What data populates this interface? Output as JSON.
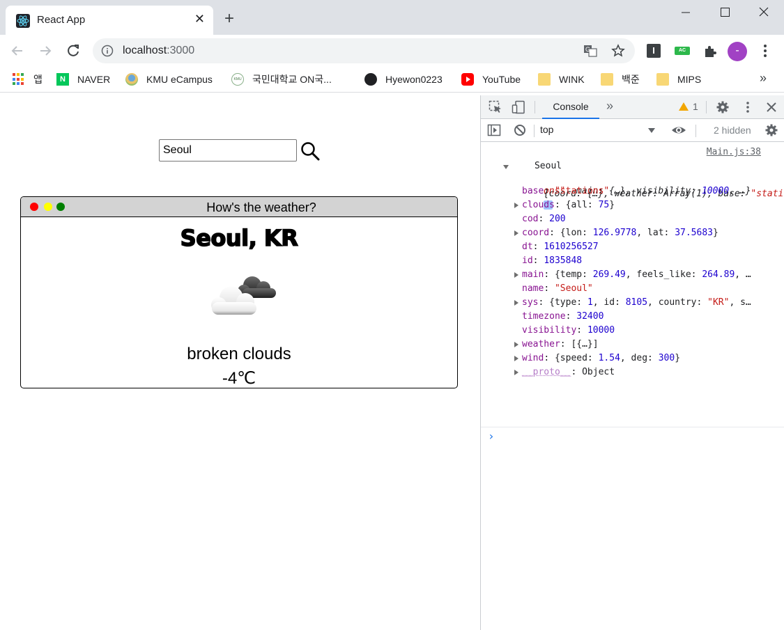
{
  "browser": {
    "tab_title": "React App",
    "tab_close": "✕",
    "new_tab": "+",
    "url_host": "localhost",
    "url_port": ":3000",
    "avatar_letter": "-",
    "ext_i": "I",
    "ext_ac": "AC",
    "bookmarks": [
      "앱",
      "NAVER",
      "KMU eCampus",
      "국민대학교 ON국...",
      "Hyewon0223",
      "YouTube",
      "WINK",
      "백준",
      "MIPS"
    ],
    "bookmarks_more": "»",
    "naver_letter": "N",
    "kmu_mark": "KMU"
  },
  "page": {
    "search_value": "Seoul",
    "card_title": "How's the weather?",
    "city": "Seoul, KR",
    "weather_icon": "broken-clouds-icon",
    "description": "broken clouds",
    "temperature": "-4℃"
  },
  "devtools": {
    "console_tab": "Console",
    "more_tabs": "»",
    "warning_count": "1",
    "context": "top",
    "hidden": "2 hidden",
    "log_text": "Seoul",
    "log_source": "Main.js:38",
    "object_summary_1a": "{coord: {…}, weather: Array(1), base: ",
    "object_summary_1b": "\"stati",
    "object_summary_2a": "ons\"",
    "object_summary_2b": ", main: {…}, visibility: ",
    "object_summary_2c": "10000",
    "object_summary_2d": ", …}",
    "info_i": "i",
    "props": [
      {
        "key": "base",
        "sep": ": ",
        "val": "\"stations\"",
        "type": "s",
        "expandable": false
      },
      {
        "key": "clouds",
        "sep": ": ",
        "val": "{all: 75}",
        "type": "o",
        "expandable": true
      },
      {
        "key": "cod",
        "sep": ": ",
        "val": "200",
        "type": "n",
        "expandable": false
      },
      {
        "key": "coord",
        "sep": ": ",
        "val": "{lon: 126.9778, lat: 37.5683}",
        "type": "o",
        "expandable": true
      },
      {
        "key": "dt",
        "sep": ": ",
        "val": "1610256527",
        "type": "n",
        "expandable": false
      },
      {
        "key": "id",
        "sep": ": ",
        "val": "1835848",
        "type": "n",
        "expandable": false
      },
      {
        "key": "main",
        "sep": ": ",
        "val": "{temp: 269.49, feels_like: 264.89, …",
        "type": "o",
        "expandable": true
      },
      {
        "key": "name",
        "sep": ": ",
        "val": "\"Seoul\"",
        "type": "s",
        "expandable": false
      },
      {
        "key": "sys",
        "sep": ": ",
        "val": "{type: 1, id: 8105, country: \"KR\", s…",
        "type": "o",
        "expandable": true
      },
      {
        "key": "timezone",
        "sep": ": ",
        "val": "32400",
        "type": "n",
        "expandable": false
      },
      {
        "key": "visibility",
        "sep": ": ",
        "val": "10000",
        "type": "n",
        "expandable": false
      },
      {
        "key": "weather",
        "sep": ": ",
        "val": "[{…}]",
        "type": "o",
        "expandable": true
      },
      {
        "key": "wind",
        "sep": ": ",
        "val": "{speed: 1.54, deg: 300}",
        "type": "o",
        "expandable": true
      },
      {
        "key": "__proto__",
        "sep": ": ",
        "val": "Object",
        "type": "p",
        "expandable": true
      }
    ],
    "prompt": "›"
  },
  "colors": {
    "accent": "#1a73e8",
    "dot_red": "#ff0000",
    "dot_yellow": "#ffff00",
    "dot_green": "#008000",
    "warning": "#f2a600"
  }
}
